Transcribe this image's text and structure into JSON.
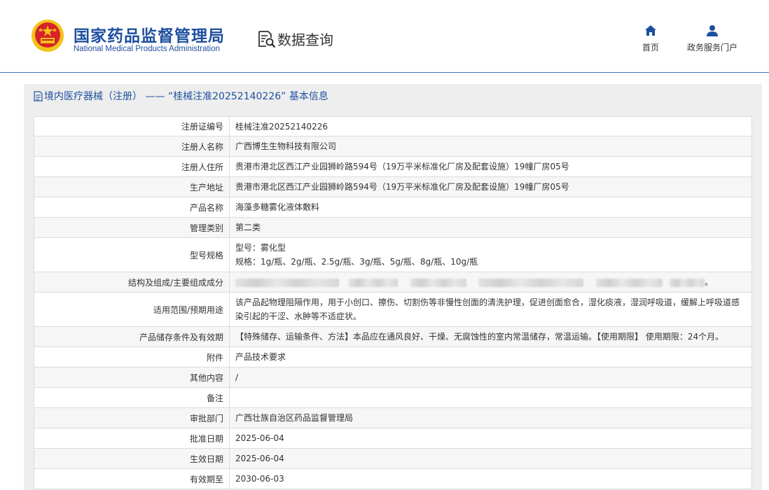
{
  "header": {
    "logo_cn": "国家药品监督管理局",
    "logo_en": "National Medical Products Administration",
    "query_title": "数据查询",
    "nav": {
      "home": "首页",
      "portal": "政务服务门户"
    }
  },
  "panel": {
    "title": "境内医疗器械（注册） —— “桂械注准20252140226” 基本信息"
  },
  "rows": [
    {
      "label": "注册证编号",
      "value": "桂械注准20252140226"
    },
    {
      "label": "注册人名称",
      "value": "广西博生生物科技有限公司"
    },
    {
      "label": "注册人住所",
      "value": "贵港市港北区西江产业园狮岭路594号（19万平米标准化厂房及配套设施）19幢厂房05号"
    },
    {
      "label": "生产地址",
      "value": "贵港市港北区西江产业园狮岭路594号（19万平米标准化厂房及配套设施）19幢厂房05号"
    },
    {
      "label": "产品名称",
      "value": "海藻多糖雾化液体敷料"
    },
    {
      "label": "管理类别",
      "value": "第二类"
    },
    {
      "label": "型号规格",
      "line1": "型号：雾化型",
      "line2": "规格：1g/瓶、2g/瓶、2.5g/瓶、3g/瓶、5g/瓶、8g/瓶、10g/瓶"
    },
    {
      "label": "结构及组成/主要组成成分",
      "value_end": "。"
    },
    {
      "label": "适用范围/预期用途",
      "value": "该产品起物理阻隔作用，用于小创口、擦伤、切割伤等非慢性创面的清洗护理，促进创面愈合，湿化痰液，湿润呼吸道，缓解上呼吸道感染引起的干涩、水肿等不适症状。"
    },
    {
      "label": "产品储存条件及有效期",
      "value": "【特殊储存、运输条件、方法】本品应在通风良好、干燥、无腐蚀性的室内常温储存，常温运输。【使用期限】 使用期限：24个月。"
    },
    {
      "label": "附件",
      "value": "产品技术要求"
    },
    {
      "label": "其他内容",
      "value": "/"
    },
    {
      "label": "备注",
      "value": ""
    },
    {
      "label": "审批部门",
      "value": "广西壮族自治区药品监督管理局"
    },
    {
      "label": "批准日期",
      "value": "2025-06-04"
    },
    {
      "label": "生效日期",
      "value": "2025-06-04"
    },
    {
      "label": "有效期至",
      "value": "2030-06-03"
    }
  ],
  "colors": {
    "brand_blue": "#1e4f9f",
    "emblem_red": "#d8232a",
    "emblem_gold": "#f2c318"
  }
}
